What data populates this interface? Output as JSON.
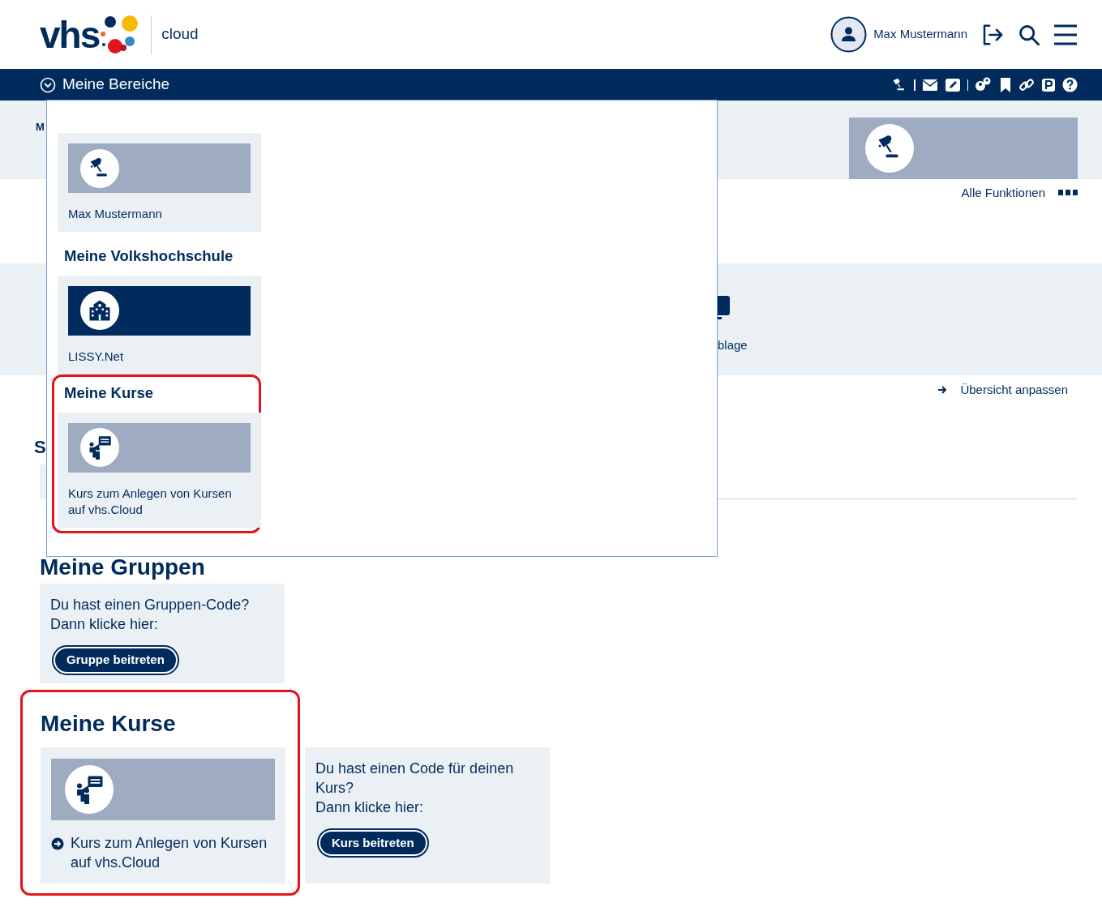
{
  "header": {
    "logo": "vhs",
    "product": "cloud",
    "user_name": "Max Mustermann"
  },
  "navbar": {
    "title": "Meine Bereiche",
    "expanded": true
  },
  "menu": {
    "sections": [
      {
        "highlighted": false,
        "tiles": [
          {
            "kind": "user",
            "color": "#9eabc0",
            "label": "Max Mustermann"
          }
        ]
      },
      {
        "heading": "Meine Volkshochschule",
        "highlighted": false,
        "tiles": [
          {
            "kind": "institution",
            "color": "#002b5c",
            "label": "LISSY.Net"
          }
        ]
      },
      {
        "heading": "Meine Kurse",
        "highlighted": true,
        "tiles": [
          {
            "kind": "course",
            "color": "#9eabc0",
            "label": "Kurs zum Anlegen von Kursen auf vhs.Cloud"
          }
        ]
      }
    ]
  },
  "breadcrumb": "M",
  "all_functions": "Alle Funktionen",
  "shortcut_label": "blage",
  "overview_link": "Übersicht anpassen",
  "section_heading": "S",
  "groups": {
    "heading": "Meine Gruppen",
    "prompt": "Du hast einen Gruppen-Code?\nDann klicke hier:",
    "button": "Gruppe beitreten"
  },
  "courses": {
    "heading": "Meine Kurse",
    "highlighted": true,
    "tile": {
      "kind": "course",
      "color": "#9eabc0",
      "label": "Kurs zum Anlegen von Kursen auf vhs.Cloud"
    },
    "prompt": "Du hast einen Code für deinen Kurs?\nDann klicke hier:",
    "button": "Kurs beitreten"
  }
}
